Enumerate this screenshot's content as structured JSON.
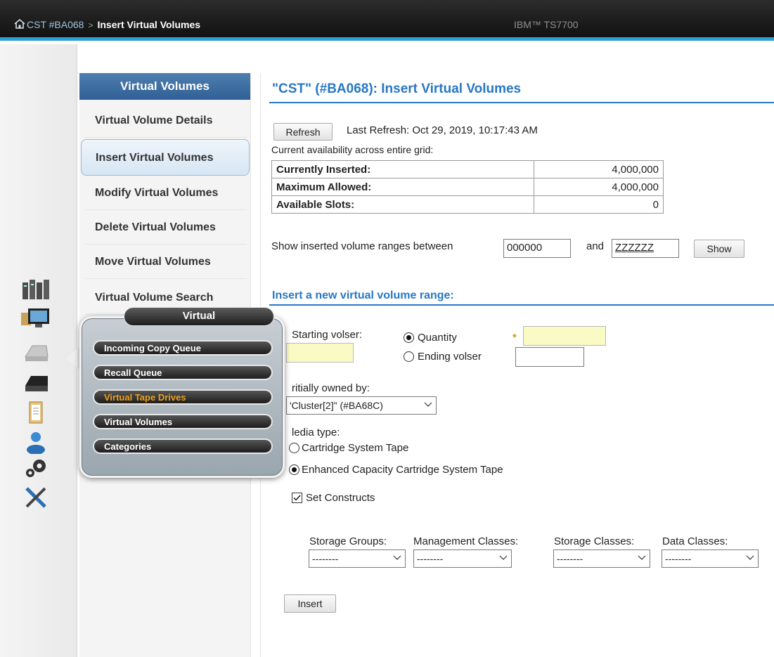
{
  "header": {
    "breadcrumb_parent": "CST #BA068",
    "separator": ">",
    "breadcrumb_current": "Insert Virtual Volumes",
    "product": "IBM™ TS7700"
  },
  "rail_icons": [
    "cluster-icon",
    "monitor-icon",
    "virtual-icon",
    "physical-icon",
    "clipboard-icon",
    "user-icon",
    "gears-icon",
    "tools-icon"
  ],
  "nav": {
    "header": "Virtual Volumes",
    "items": [
      {
        "label": "Virtual Volume Details",
        "active": false
      },
      {
        "label": "Insert Virtual Volumes",
        "active": true
      },
      {
        "label": "Modify Virtual Volumes",
        "active": false
      },
      {
        "label": "Delete Virtual Volumes",
        "active": false
      },
      {
        "label": "Move Virtual Volumes",
        "active": false
      },
      {
        "label": "Virtual Volume Search",
        "active": false
      }
    ]
  },
  "popup": {
    "title": "Virtual",
    "items": [
      {
        "label": "Incoming Copy Queue",
        "selected": false
      },
      {
        "label": "Recall Queue",
        "selected": false
      },
      {
        "label": "Virtual Tape Drives",
        "selected": true
      },
      {
        "label": "Virtual Volumes",
        "selected": false
      },
      {
        "label": "Categories",
        "selected": false
      }
    ]
  },
  "main": {
    "title": "\"CST\" (#BA068): Insert Virtual Volumes",
    "refresh_label": "Refresh",
    "last_refresh": "Last Refresh:  Oct 29, 2019, 10:17:43 AM",
    "availability_label": "Current availability across entire grid:",
    "availability": [
      {
        "label": "Currently Inserted:",
        "value": "4,000,000"
      },
      {
        "label": "Maximum Allowed:",
        "value": "4,000,000"
      },
      {
        "label": "Available Slots:",
        "value": "0"
      }
    ],
    "range_label": "Show inserted volume ranges between",
    "range_from": "000000",
    "range_and": "and",
    "range_to": "ZZZZZZ",
    "show_label": "Show",
    "insert_title": "Insert a new virtual volume range:",
    "starting_volser_label": "Starting volser:",
    "required_mark": "*",
    "quantity_label": "Quantity",
    "quantity_selected": true,
    "ending_volser_label": "Ending volser",
    "owned_by_label": "ritially owned by:",
    "owned_by_value": "'Cluster[2]\" (#BA68C)",
    "media_type_label": "ledia type:",
    "media_options": [
      {
        "label": "Cartridge System Tape",
        "selected": false
      },
      {
        "label": "Enhanced Capacity Cartridge System Tape",
        "selected": true
      }
    ],
    "set_constructs_label": "Set Constructs",
    "set_constructs_checked": true,
    "constructs": [
      {
        "label": "Storage Groups:",
        "value": "--------"
      },
      {
        "label": "Management Classes:",
        "value": "--------"
      },
      {
        "label": "Storage Classes:",
        "value": "--------"
      },
      {
        "label": "Data Classes:",
        "value": "--------"
      }
    ],
    "insert_label": "Insert"
  }
}
